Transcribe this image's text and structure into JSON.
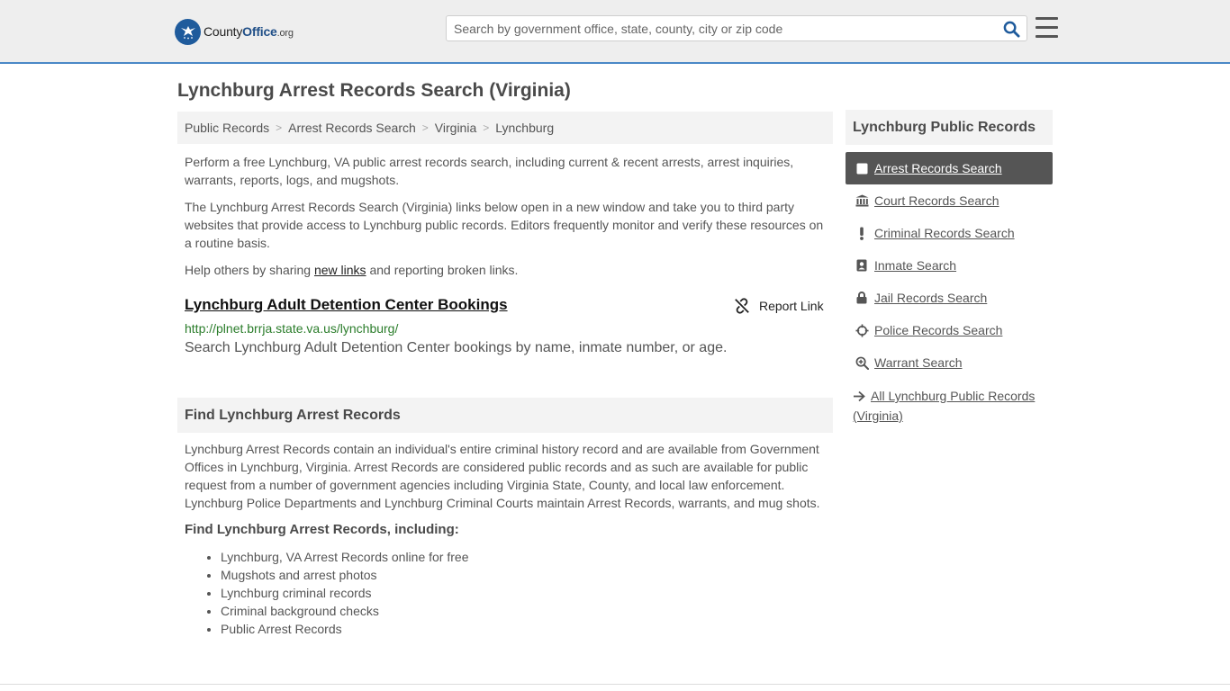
{
  "header": {
    "logo_main": "County",
    "logo_bold": "Office",
    "logo_org": ".org",
    "search_placeholder": "Search by government office, state, county, city or zip code"
  },
  "page_title": "Lynchburg Arrest Records Search (Virginia)",
  "breadcrumb": [
    "Public Records",
    "Arrest Records Search",
    "Virginia",
    "Lynchburg"
  ],
  "intro": {
    "p1": "Perform a free Lynchburg, VA public arrest records search, including current & recent arrests, arrest inquiries, warrants, reports, logs, and mugshots.",
    "p2": "The Lynchburg Arrest Records Search (Virginia) links below open in a new window and take you to third party websites that provide access to Lynchburg public records. Editors frequently monitor and verify these resources on a routine basis.",
    "p3_before": "Help others by sharing ",
    "p3_link": "new links",
    "p3_after": " and reporting broken links."
  },
  "result": {
    "title": "Lynchburg Adult Detention Center Bookings",
    "report_label": "Report Link",
    "url": "http://plnet.brrja.state.va.us/lynchburg/",
    "description": "Search Lynchburg Adult Detention Center bookings by name, inmate number, or age."
  },
  "find_section": {
    "heading": "Find Lynchburg Arrest Records",
    "body": "Lynchburg Arrest Records contain an individual's entire criminal history record and are available from Government Offices in Lynchburg, Virginia. Arrest Records are considered public records and as such are available for public request from a number of government agencies including Virginia State, County, and local law enforcement. Lynchburg Police Departments and Lynchburg Criminal Courts maintain Arrest Records, warrants, and mug shots.",
    "subheading": "Find Lynchburg Arrest Records, including:",
    "items": [
      "Lynchburg, VA Arrest Records online for free",
      "Mugshots and arrest photos",
      "Lynchburg criminal records",
      "Criminal background checks",
      "Public Arrest Records"
    ]
  },
  "sidebar": {
    "heading": "Lynchburg Public Records",
    "items": [
      {
        "label": "Arrest Records Search",
        "icon": "square-icon"
      },
      {
        "label": "Court Records Search",
        "icon": "courthouse-icon"
      },
      {
        "label": "Criminal Records Search",
        "icon": "exclamation-icon"
      },
      {
        "label": "Inmate Search",
        "icon": "id-badge-icon"
      },
      {
        "label": "Jail Records Search",
        "icon": "lock-icon"
      },
      {
        "label": "Police Records Search",
        "icon": "crosshair-icon"
      },
      {
        "label": "Warrant Search",
        "icon": "magnify-plus-icon"
      }
    ],
    "all_label": "All Lynchburg Public Records (Virginia)"
  }
}
